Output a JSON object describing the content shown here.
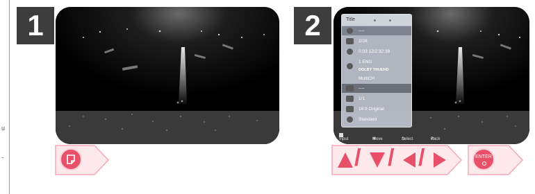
{
  "margin": {
    "mark_top": "u",
    "mark_bottom": "-"
  },
  "steps": [
    {
      "number": "1"
    },
    {
      "number": "2"
    }
  ],
  "osd": {
    "title": "Title",
    "rows": [
      {
        "icon": "disc-icon",
        "text": "----"
      },
      {
        "icon": "chapter-icon",
        "text": "2/28"
      },
      {
        "icon": "clock-icon",
        "text": "0:03:12/2:32:38"
      },
      {
        "icon": "audio-icon",
        "text": "1 ENG"
      },
      {
        "icon": "audio-format-icon",
        "text": "DOLBY TRUEHD"
      },
      {
        "icon": "channel-icon",
        "text": "MultiCH"
      },
      {
        "icon": "subtitle-icon",
        "text": "----"
      },
      {
        "icon": "angle-icon",
        "text": "1/1"
      },
      {
        "icon": "aspect-icon",
        "text": "16:9 Original"
      },
      {
        "icon": "picture-mode-icon",
        "text": "Standard"
      }
    ],
    "bottom_bar": {
      "input": "Input",
      "move": "Move",
      "select": "Select",
      "back": "Back"
    }
  },
  "remote": {
    "info_button_label": "",
    "enter_label": "ENTER",
    "arrow_separator": "/",
    "accent_color": "#e8506a",
    "chip_color": "#fde8ec"
  }
}
